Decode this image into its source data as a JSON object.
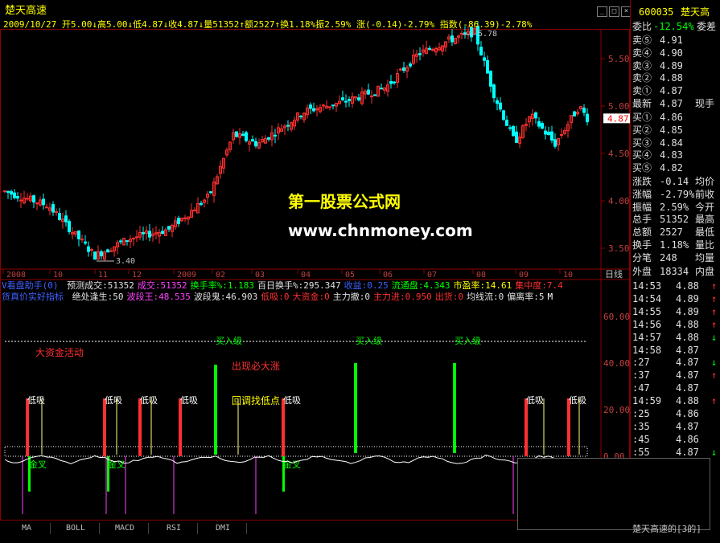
{
  "app": {
    "stock_name": "楚天高速",
    "code": "600035",
    "stock_name_short": "楚天高",
    "window_buttons": [
      "_",
      "□",
      "×"
    ]
  },
  "ohlc": {
    "text": "2009/10/27 开5.00↓高5.00↓低4.87↓收4.87↓量51352↑额2527↑换1.18%振2.59% 涨(-0.14)-2.79% 指数(-86.39)-2.78%"
  },
  "watermark": {
    "line1": "第一股票公式网",
    "line2": "www.chnmoney.com"
  },
  "price_axis": [
    "5.50",
    "5.00",
    "4.50",
    "4.00",
    "3.50"
  ],
  "price_markers": {
    "high": "5.78",
    "low": "3.40",
    "current": "4.87"
  },
  "date_axis": [
    "2008",
    "10",
    "11",
    "12",
    "2009",
    "02",
    "03",
    "04",
    "05",
    "06",
    "07",
    "08",
    "09",
    "10"
  ],
  "date_axis_unit": "日线",
  "indicator_line1": {
    "name": "V看盘助手(0)",
    "items": [
      {
        "label": "预测成交:",
        "value": "51352",
        "color": "#e0e0e0"
      },
      {
        "label": "成交:",
        "value": "51352",
        "color": "#ff40ff"
      },
      {
        "label": "换手率%:",
        "value": "1.183",
        "color": "#00ff00"
      },
      {
        "label": "百日换手%:",
        "value": "295.347",
        "color": "#e0e0e0"
      },
      {
        "label": "收益:",
        "value": "0.25",
        "color": "#4060ff"
      },
      {
        "label": "流通盘:",
        "value": "4.343",
        "color": "#00ff00"
      },
      {
        "label": "市盈率:",
        "value": "14.61",
        "color": "#ffff00"
      },
      {
        "label": "集中度:",
        "value": "7.4",
        "color": "#ff3030"
      }
    ]
  },
  "indicator_line2": {
    "name": "货真价实好指标",
    "items": [
      {
        "label": "绝处逢生:",
        "value": "50",
        "color": "#e0e0e0"
      },
      {
        "label": "波段王:",
        "value": "48.535",
        "color": "#ff40ff"
      },
      {
        "label": "波段鬼:",
        "value": "46.903",
        "color": "#e0e0e0"
      },
      {
        "label": "低吸:",
        "value": "0",
        "color": "#ff3030"
      },
      {
        "label": "大资金:",
        "value": "0",
        "color": "#ff3030"
      },
      {
        "label": "主力撤:",
        "value": "0",
        "color": "#e0e0e0"
      },
      {
        "label": "主力进:",
        "value": "0.950",
        "color": "#ff3030"
      },
      {
        "label": "出货:",
        "value": "0",
        "color": "#ff3030"
      },
      {
        "label": "均线流:",
        "value": "0",
        "color": "#e0e0e0"
      },
      {
        "label": "偏离率:",
        "value": "5",
        "color": "#e0e0e0"
      },
      {
        "label": "",
        "value": "M",
        "color": "#ffffff"
      }
    ]
  },
  "indicator_axis": [
    "60.00",
    "40.00",
    "20.00",
    "0.00"
  ],
  "signals": {
    "big_money": "大资金活动",
    "buy_levels": [
      "买入级",
      "买入级",
      "买入级"
    ],
    "appear_surge": "出现必大涨",
    "pullback": "回调找低点",
    "low_buy": "低吸",
    "golden_cross": "金叉"
  },
  "tabs": [
    "MA",
    "BOLL",
    "MACD",
    "RSI",
    "DMI"
  ],
  "right_panel": {
    "weibi_label": "委比",
    "weibi_value": "-12.54%",
    "weicha_label": "委差",
    "sell": [
      {
        "label": "卖⑤",
        "price": "4.91"
      },
      {
        "label": "卖④",
        "price": "4.90"
      },
      {
        "label": "卖③",
        "price": "4.89"
      },
      {
        "label": "卖②",
        "price": "4.88"
      },
      {
        "label": "卖①",
        "price": "4.87"
      }
    ],
    "latest_label": "最新",
    "latest_value": "4.87",
    "now_hand_label": "现手",
    "buy": [
      {
        "label": "买①",
        "price": "4.86"
      },
      {
        "label": "买②",
        "price": "4.85"
      },
      {
        "label": "买③",
        "price": "4.84"
      },
      {
        "label": "买④",
        "price": "4.83"
      },
      {
        "label": "买⑤",
        "price": "4.82"
      }
    ],
    "stats": [
      {
        "label": "涨跌",
        "value": "-0.14",
        "right": "均价"
      },
      {
        "label": "涨幅",
        "value": "-2.79%",
        "right": "前收"
      },
      {
        "label": "振幅",
        "value": "2.59%",
        "right": "今开"
      },
      {
        "label": "总手",
        "value": "51352",
        "right": "最高"
      },
      {
        "label": "总额",
        "value": "2527",
        "right": "最低"
      },
      {
        "label": "换手",
        "value": "1.18%",
        "right": "量比"
      },
      {
        "label": "分笔",
        "value": "248",
        "right": "均量"
      }
    ],
    "outer_label": "外盘",
    "outer_value": "18334",
    "inner_label": "内盘",
    "ticks": [
      {
        "time": "14:53",
        "price": "4.88",
        "dir": "↑"
      },
      {
        "time": "14:54",
        "price": "4.89",
        "dir": "↑"
      },
      {
        "time": "14:55",
        "price": "4.89",
        "dir": "↑"
      },
      {
        "time": "14:56",
        "price": "4.88",
        "dir": "↑"
      },
      {
        "time": "14:57",
        "price": "4.88",
        "dir": "↓"
      },
      {
        "time": "14:58",
        "price": "4.87",
        "dir": ""
      },
      {
        "time": ":27",
        "price": "4.87",
        "dir": "↓"
      },
      {
        "time": ":37",
        "price": "4.87",
        "dir": "↑"
      },
      {
        "time": ":47",
        "price": "4.87",
        "dir": ""
      },
      {
        "time": "14:59",
        "price": "4.88",
        "dir": "↑"
      },
      {
        "time": ":25",
        "price": "4.86",
        "dir": ""
      },
      {
        "time": ":35",
        "price": "4.87",
        "dir": ""
      },
      {
        "time": ":45",
        "price": "4.86",
        "dir": ""
      },
      {
        "time": ":55",
        "price": "4.87",
        "dir": "↓"
      }
    ],
    "bottom_link": "楚天高速的[3的]"
  },
  "colors": {
    "up": "#ff3030",
    "down": "#00ffff",
    "grid": "#8b0000"
  }
}
